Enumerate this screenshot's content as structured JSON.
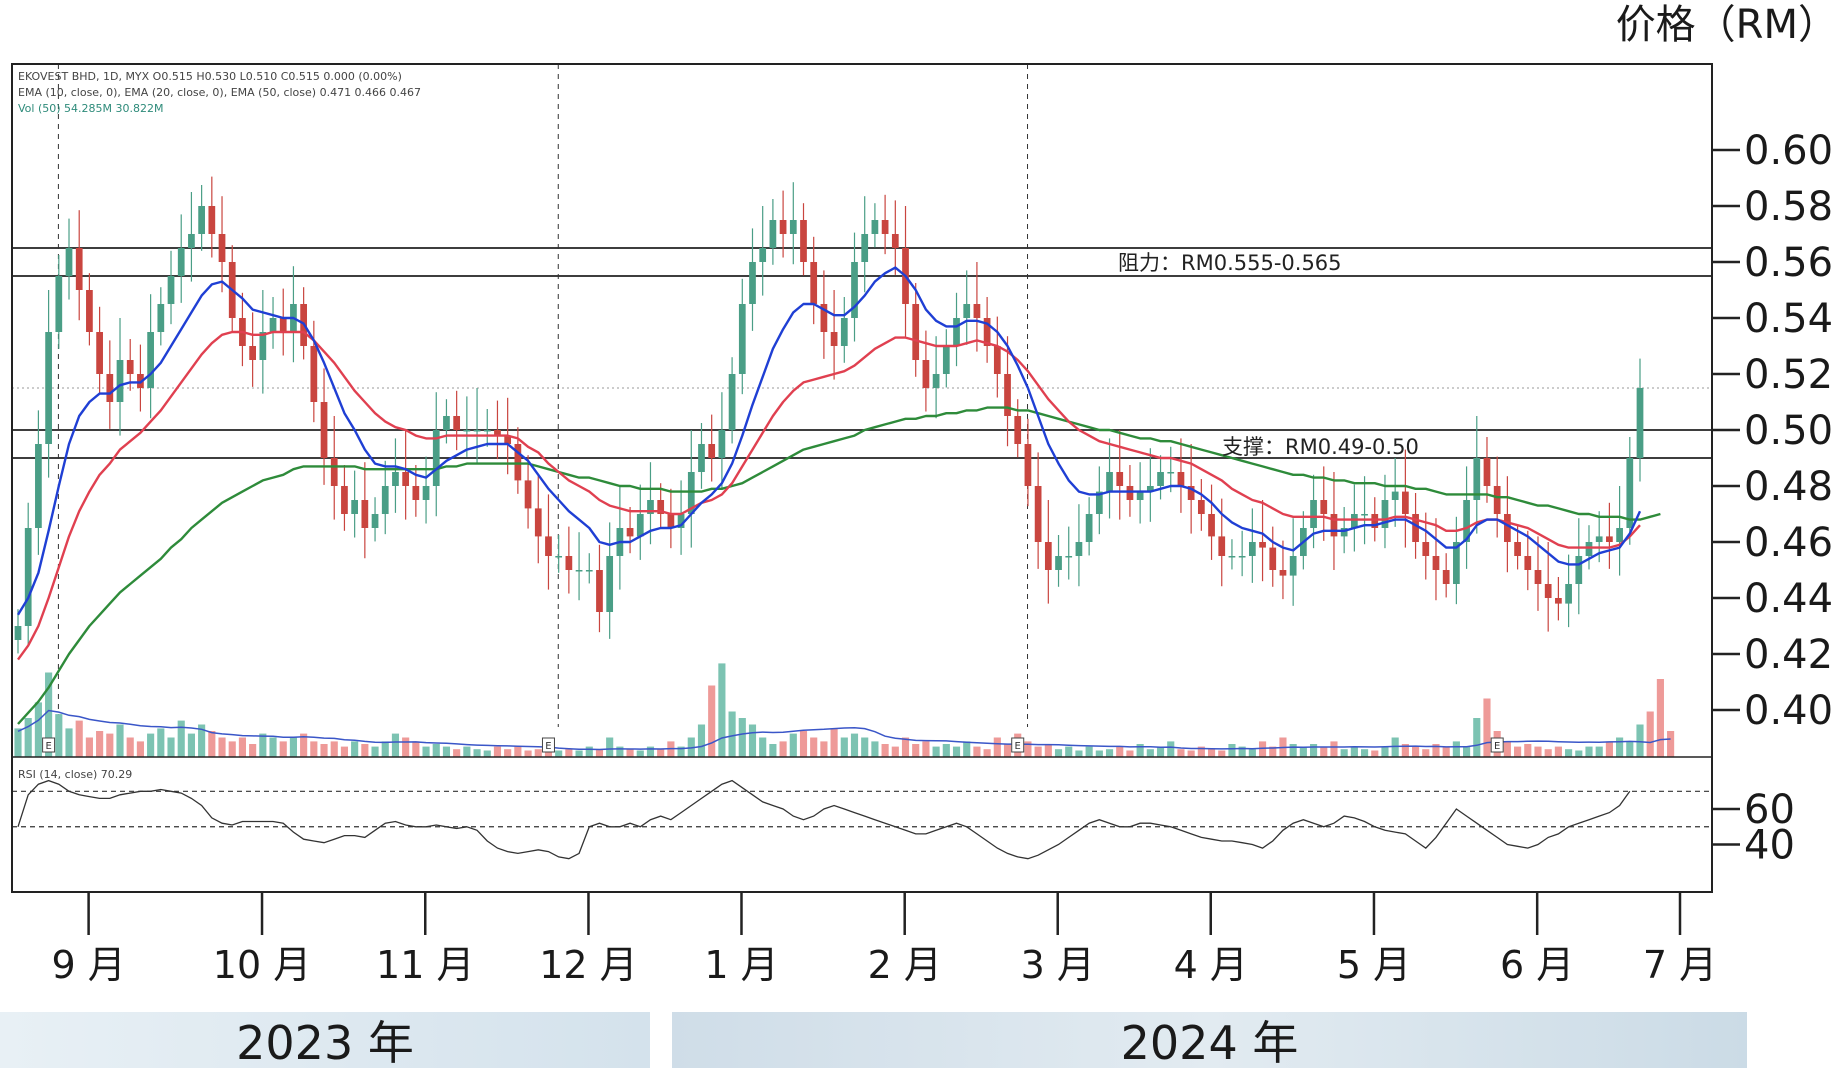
{
  "header": {
    "price_unit": "价格（RM）"
  },
  "panel_info": {
    "line1": "EKOVEST BHD, 1D, MYX  O0.515 H0.530 L0.510 C0.515  0.000 (0.00%)",
    "line2": "EMA (10, close, 0), EMA (20, close, 0), EMA (50, close)  0.471  0.466  0.467",
    "line3": "Vol (50)  54.285M  30.822M",
    "rsi": "RSI (14, close)  70.29"
  },
  "annotations": {
    "resistance": "阻力：RM0.555-0.565",
    "support": "支撑：RM0.49-0.50"
  },
  "earnings_marker": "E",
  "years": {
    "y2023": "2023 年",
    "y2024": "2024 年"
  },
  "colors": {
    "up": "#4a9e86",
    "down": "#c9453f",
    "ema_fast": "#1f3fd4",
    "ema_mid": "#e04050",
    "ema_slow": "#2e8b3a",
    "vol_up": "#7cc3b2",
    "vol_down": "#ee9a98",
    "grid": "#222222"
  },
  "chart_data": {
    "type": "candlestick",
    "title": "",
    "ylabel": "价格（RM）",
    "ylim": [
      0.38,
      0.615
    ],
    "yticks": [
      "0.60",
      "0.58",
      "0.56",
      "0.54",
      "0.52",
      "0.50",
      "0.48",
      "0.46",
      "0.44",
      "0.42",
      "0.40"
    ],
    "ytick_values": [
      0.6,
      0.58,
      0.56,
      0.54,
      0.52,
      0.5,
      0.48,
      0.46,
      0.44,
      0.42,
      0.4
    ],
    "months": [
      "9 月",
      "10 月",
      "11 月",
      "12 月",
      "1 月",
      "2 月",
      "3 月",
      "4 月",
      "5 月",
      "6 月",
      "7 月"
    ],
    "month_start_index": [
      3,
      20,
      36,
      52,
      67,
      83,
      98,
      113,
      129,
      145,
      159
    ],
    "earnings_index": [
      3,
      52,
      98,
      145
    ],
    "hlines": [
      0.565,
      0.555,
      0.5,
      0.49
    ],
    "rsi_ylim": [
      20,
      82
    ],
    "rsi_levels": [
      70,
      50
    ],
    "rsi_ticks": [
      "60",
      "40"
    ],
    "rsi_tick_values": [
      60,
      40
    ],
    "close": [
      0.43,
      0.465,
      0.495,
      0.535,
      0.555,
      0.565,
      0.55,
      0.535,
      0.52,
      0.51,
      0.525,
      0.52,
      0.515,
      0.535,
      0.545,
      0.555,
      0.565,
      0.57,
      0.58,
      0.57,
      0.56,
      0.54,
      0.53,
      0.525,
      0.535,
      0.54,
      0.535,
      0.545,
      0.53,
      0.51,
      0.49,
      0.48,
      0.47,
      0.475,
      0.465,
      0.47,
      0.48,
      0.485,
      0.48,
      0.475,
      0.48,
      0.5,
      0.505,
      0.5,
      0.5,
      0.5,
      0.5,
      0.498,
      0.495,
      0.482,
      0.472,
      0.462,
      0.455,
      0.455,
      0.45,
      0.45,
      0.45,
      0.435,
      0.455,
      0.465,
      0.462,
      0.47,
      0.475,
      0.47,
      0.465,
      0.47,
      0.485,
      0.495,
      0.49,
      0.5,
      0.52,
      0.545,
      0.56,
      0.565,
      0.575,
      0.57,
      0.575,
      0.56,
      0.545,
      0.535,
      0.53,
      0.54,
      0.56,
      0.57,
      0.575,
      0.57,
      0.565,
      0.545,
      0.525,
      0.515,
      0.52,
      0.53,
      0.54,
      0.545,
      0.54,
      0.53,
      0.52,
      0.505,
      0.495,
      0.48,
      0.46,
      0.45,
      0.455,
      0.455,
      0.46,
      0.47,
      0.478,
      0.485,
      0.48,
      0.475,
      0.478,
      0.48,
      0.485,
      0.485,
      0.48,
      0.475,
      0.47,
      0.462,
      0.455,
      0.455,
      0.455,
      0.46,
      0.458,
      0.45,
      0.448,
      0.455,
      0.465,
      0.475,
      0.47,
      0.462,
      0.465,
      0.47,
      0.47,
      0.465,
      0.475,
      0.478,
      0.47,
      0.46,
      0.455,
      0.45,
      0.445,
      0.46,
      0.475,
      0.49,
      0.48,
      0.47,
      0.46,
      0.455,
      0.45,
      0.445,
      0.44,
      0.438,
      0.445,
      0.455,
      0.46,
      0.462,
      0.46,
      0.465,
      0.49,
      0.515
    ],
    "vol_ratio": [
      0.22,
      0.3,
      0.42,
      0.65,
      0.33,
      0.22,
      0.28,
      0.15,
      0.2,
      0.18,
      0.25,
      0.15,
      0.12,
      0.18,
      0.22,
      0.15,
      0.28,
      0.18,
      0.25,
      0.2,
      0.15,
      0.12,
      0.15,
      0.1,
      0.18,
      0.15,
      0.12,
      0.15,
      0.18,
      0.12,
      0.1,
      0.12,
      0.08,
      0.12,
      0.1,
      0.08,
      0.12,
      0.18,
      0.15,
      0.12,
      0.08,
      0.1,
      0.08,
      0.06,
      0.08,
      0.06,
      0.05,
      0.08,
      0.06,
      0.08,
      0.05,
      0.06,
      0.06,
      0.05,
      0.06,
      0.05,
      0.08,
      0.06,
      0.15,
      0.08,
      0.06,
      0.05,
      0.08,
      0.06,
      0.12,
      0.08,
      0.15,
      0.25,
      0.55,
      0.72,
      0.35,
      0.3,
      0.25,
      0.15,
      0.1,
      0.12,
      0.18,
      0.2,
      0.15,
      0.12,
      0.22,
      0.15,
      0.18,
      0.15,
      0.12,
      0.1,
      0.08,
      0.15,
      0.1,
      0.12,
      0.08,
      0.1,
      0.08,
      0.12,
      0.08,
      0.06,
      0.15,
      0.1,
      0.18,
      0.12,
      0.08,
      0.1,
      0.06,
      0.08,
      0.05,
      0.08,
      0.05,
      0.06,
      0.08,
      0.05,
      0.1,
      0.06,
      0.08,
      0.12,
      0.06,
      0.05,
      0.08,
      0.06,
      0.05,
      0.1,
      0.08,
      0.06,
      0.12,
      0.08,
      0.15,
      0.1,
      0.08,
      0.1,
      0.08,
      0.12,
      0.06,
      0.08,
      0.06,
      0.05,
      0.08,
      0.15,
      0.1,
      0.08,
      0.06,
      0.1,
      0.08,
      0.12,
      0.08,
      0.3,
      0.45,
      0.2,
      0.12,
      0.08,
      0.1,
      0.08,
      0.06,
      0.08,
      0.06,
      0.05,
      0.08,
      0.08,
      0.12,
      0.15,
      0.12,
      0.25,
      0.35,
      0.6,
      0.2
    ],
    "rsi": [
      50,
      68,
      74,
      76,
      74,
      70,
      68,
      67,
      66,
      66,
      68,
      69,
      70,
      70,
      71,
      70,
      69,
      66,
      62,
      55,
      52,
      51,
      53,
      53,
      53,
      53,
      52,
      47,
      43,
      42,
      41,
      43,
      45,
      45,
      44,
      48,
      52,
      53,
      51,
      50,
      50,
      51,
      50,
      49,
      50,
      48,
      42,
      38,
      36,
      35,
      36,
      37,
      36,
      33,
      32,
      35,
      50,
      52,
      50,
      50,
      52,
      50,
      54,
      56,
      54,
      58,
      62,
      66,
      70,
      74,
      76,
      72,
      68,
      64,
      62,
      60,
      56,
      54,
      56,
      60,
      62,
      60,
      58,
      56,
      54,
      52,
      50,
      48,
      46,
      46,
      48,
      50,
      52,
      50,
      46,
      42,
      38,
      35,
      33,
      32,
      34,
      37,
      40,
      44,
      48,
      52,
      54,
      52,
      50,
      50,
      52,
      52,
      51,
      50,
      48,
      46,
      44,
      43,
      42,
      42,
      41,
      40,
      38,
      42,
      48,
      52,
      54,
      52,
      50,
      52,
      56,
      55,
      53,
      50,
      48,
      47,
      46,
      42,
      38,
      44,
      52,
      60,
      56,
      52,
      48,
      44,
      40,
      39,
      38,
      40,
      44,
      46,
      50,
      52,
      54,
      56,
      58,
      62,
      70
    ],
    "ema10": [
      0.434,
      0.44,
      0.449,
      0.464,
      0.48,
      0.495,
      0.505,
      0.51,
      0.513,
      0.513,
      0.516,
      0.517,
      0.517,
      0.52,
      0.524,
      0.53,
      0.536,
      0.542,
      0.548,
      0.552,
      0.553,
      0.55,
      0.547,
      0.543,
      0.542,
      0.541,
      0.54,
      0.54,
      0.538,
      0.532,
      0.524,
      0.515,
      0.506,
      0.5,
      0.493,
      0.488,
      0.487,
      0.487,
      0.486,
      0.484,
      0.483,
      0.486,
      0.489,
      0.491,
      0.493,
      0.494,
      0.495,
      0.495,
      0.495,
      0.492,
      0.489,
      0.484,
      0.479,
      0.475,
      0.471,
      0.468,
      0.465,
      0.46,
      0.459,
      0.46,
      0.46,
      0.462,
      0.464,
      0.465,
      0.465,
      0.466,
      0.47,
      0.474,
      0.477,
      0.481,
      0.488,
      0.498,
      0.509,
      0.519,
      0.529,
      0.536,
      0.542,
      0.545,
      0.545,
      0.543,
      0.541,
      0.541,
      0.544,
      0.548,
      0.553,
      0.556,
      0.558,
      0.555,
      0.55,
      0.543,
      0.539,
      0.537,
      0.537,
      0.539,
      0.539,
      0.538,
      0.535,
      0.53,
      0.523,
      0.515,
      0.505,
      0.495,
      0.488,
      0.482,
      0.478,
      0.477,
      0.477,
      0.478,
      0.478,
      0.478,
      0.478,
      0.478,
      0.479,
      0.48,
      0.48,
      0.479,
      0.477,
      0.474,
      0.47,
      0.467,
      0.465,
      0.464,
      0.463,
      0.46,
      0.458,
      0.457,
      0.46,
      0.463,
      0.464,
      0.464,
      0.464,
      0.465,
      0.466,
      0.466,
      0.467,
      0.468,
      0.468,
      0.466,
      0.464,
      0.461,
      0.458,
      0.458,
      0.461,
      0.466,
      0.468,
      0.468,
      0.466,
      0.464,
      0.462,
      0.459,
      0.456,
      0.453,
      0.452,
      0.452,
      0.454,
      0.456,
      0.457,
      0.458,
      0.463,
      0.471
    ],
    "ema20": [
      0.418,
      0.423,
      0.43,
      0.44,
      0.451,
      0.462,
      0.471,
      0.478,
      0.484,
      0.488,
      0.493,
      0.496,
      0.499,
      0.503,
      0.507,
      0.512,
      0.517,
      0.522,
      0.527,
      0.531,
      0.534,
      0.535,
      0.535,
      0.534,
      0.534,
      0.535,
      0.535,
      0.535,
      0.535,
      0.532,
      0.528,
      0.524,
      0.519,
      0.514,
      0.51,
      0.506,
      0.503,
      0.501,
      0.5,
      0.498,
      0.497,
      0.497,
      0.498,
      0.498,
      0.498,
      0.498,
      0.498,
      0.498,
      0.498,
      0.497,
      0.494,
      0.492,
      0.488,
      0.485,
      0.482,
      0.48,
      0.478,
      0.475,
      0.473,
      0.472,
      0.471,
      0.471,
      0.471,
      0.471,
      0.47,
      0.47,
      0.472,
      0.474,
      0.475,
      0.477,
      0.481,
      0.487,
      0.493,
      0.499,
      0.505,
      0.51,
      0.514,
      0.517,
      0.518,
      0.519,
      0.52,
      0.521,
      0.523,
      0.526,
      0.529,
      0.531,
      0.533,
      0.533,
      0.532,
      0.531,
      0.53,
      0.53,
      0.53,
      0.531,
      0.532,
      0.531,
      0.53,
      0.528,
      0.525,
      0.521,
      0.516,
      0.511,
      0.507,
      0.503,
      0.5,
      0.498,
      0.496,
      0.495,
      0.494,
      0.493,
      0.492,
      0.491,
      0.49,
      0.49,
      0.489,
      0.488,
      0.486,
      0.484,
      0.482,
      0.479,
      0.477,
      0.475,
      0.474,
      0.472,
      0.47,
      0.469,
      0.469,
      0.469,
      0.469,
      0.468,
      0.468,
      0.468,
      0.468,
      0.468,
      0.468,
      0.469,
      0.469,
      0.468,
      0.467,
      0.466,
      0.464,
      0.464,
      0.465,
      0.467,
      0.468,
      0.468,
      0.467,
      0.466,
      0.465,
      0.463,
      0.461,
      0.459,
      0.458,
      0.458,
      0.458,
      0.458,
      0.458,
      0.459,
      0.462,
      0.466
    ],
    "ema50": [
      0.395,
      0.399,
      0.403,
      0.408,
      0.414,
      0.42,
      0.425,
      0.43,
      0.434,
      0.438,
      0.442,
      0.445,
      0.448,
      0.451,
      0.454,
      0.458,
      0.461,
      0.465,
      0.468,
      0.471,
      0.474,
      0.476,
      0.478,
      0.48,
      0.482,
      0.483,
      0.484,
      0.486,
      0.487,
      0.487,
      0.487,
      0.487,
      0.487,
      0.487,
      0.486,
      0.486,
      0.486,
      0.486,
      0.486,
      0.486,
      0.486,
      0.486,
      0.487,
      0.487,
      0.488,
      0.488,
      0.488,
      0.488,
      0.488,
      0.488,
      0.488,
      0.487,
      0.486,
      0.485,
      0.484,
      0.483,
      0.483,
      0.482,
      0.481,
      0.48,
      0.48,
      0.479,
      0.479,
      0.479,
      0.478,
      0.478,
      0.478,
      0.478,
      0.479,
      0.479,
      0.48,
      0.481,
      0.483,
      0.485,
      0.487,
      0.489,
      0.491,
      0.493,
      0.494,
      0.495,
      0.496,
      0.497,
      0.498,
      0.5,
      0.501,
      0.502,
      0.503,
      0.504,
      0.504,
      0.505,
      0.505,
      0.506,
      0.506,
      0.507,
      0.507,
      0.508,
      0.508,
      0.508,
      0.507,
      0.507,
      0.506,
      0.505,
      0.504,
      0.503,
      0.502,
      0.501,
      0.5,
      0.5,
      0.499,
      0.498,
      0.497,
      0.497,
      0.496,
      0.496,
      0.495,
      0.494,
      0.493,
      0.492,
      0.491,
      0.49,
      0.489,
      0.488,
      0.487,
      0.486,
      0.485,
      0.484,
      0.484,
      0.483,
      0.483,
      0.482,
      0.482,
      0.481,
      0.481,
      0.481,
      0.48,
      0.48,
      0.48,
      0.479,
      0.479,
      0.478,
      0.477,
      0.477,
      0.477,
      0.477,
      0.477,
      0.476,
      0.476,
      0.475,
      0.474,
      0.473,
      0.473,
      0.472,
      0.471,
      0.47,
      0.47,
      0.469,
      0.469,
      0.469,
      0.468,
      0.468,
      0.469,
      0.47
    ]
  }
}
